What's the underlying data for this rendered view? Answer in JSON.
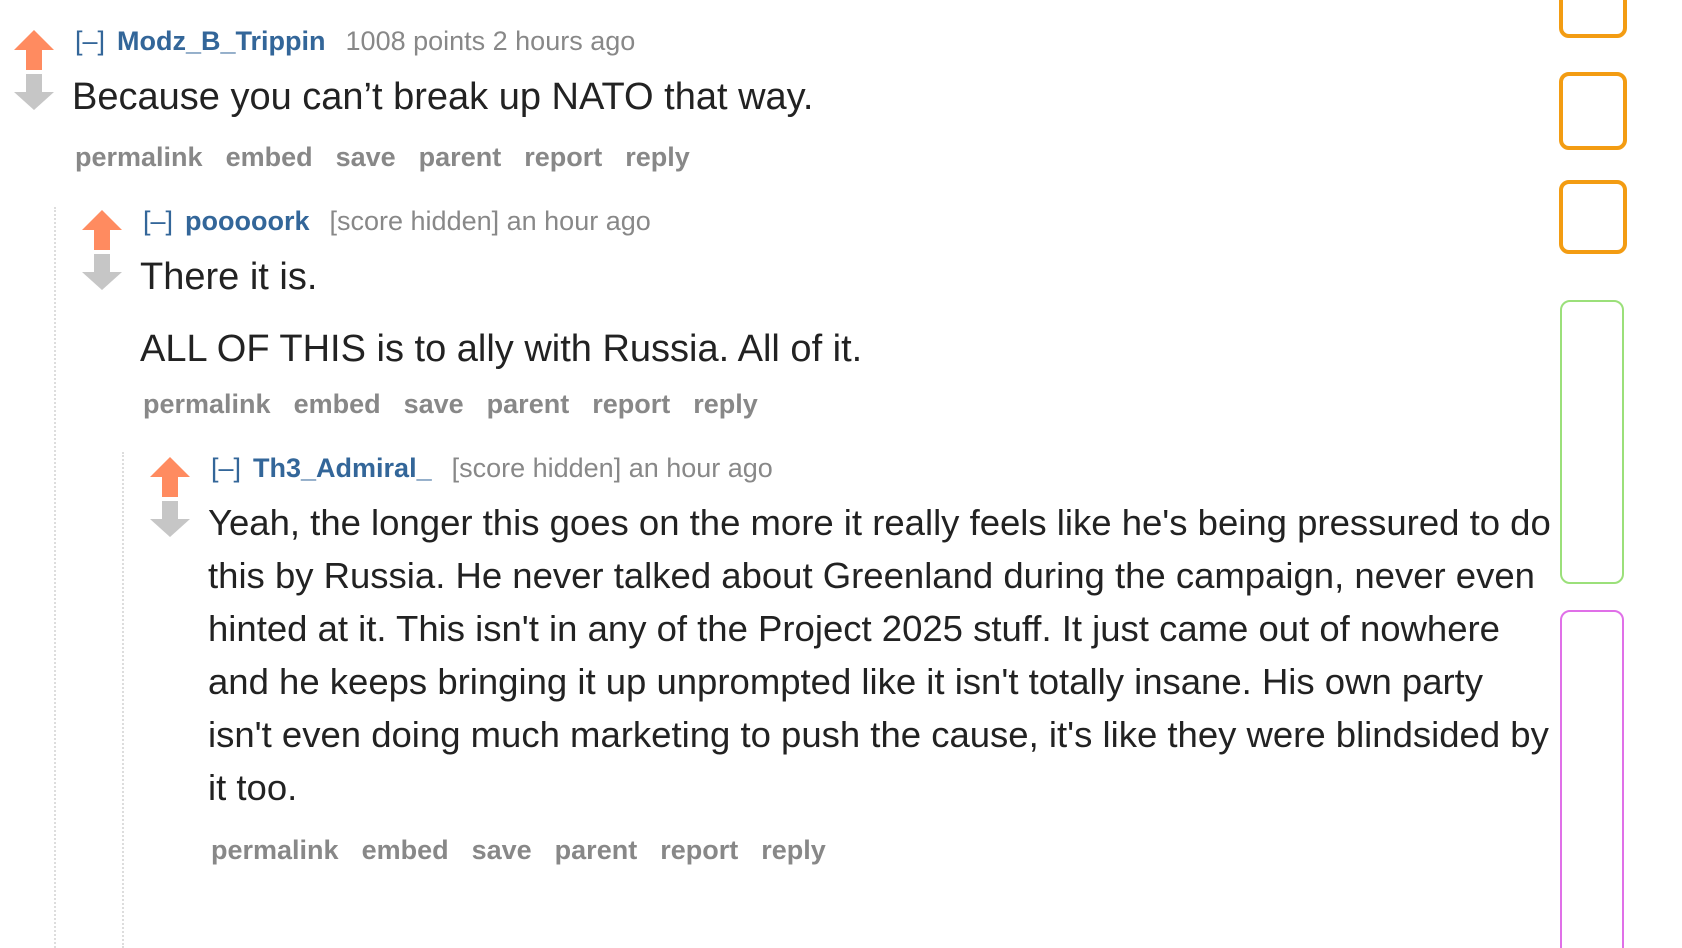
{
  "colors": {
    "upvote": "#ff8b60",
    "downvote": "#c6c6c6",
    "author": "#336699",
    "meta": "#888888",
    "body_text": "#222222"
  },
  "icons": {
    "upvote": "upvote-arrow-icon",
    "downvote": "downvote-arrow-icon"
  },
  "comments": [
    {
      "expand": "[–]",
      "author": "Modz_B_Trippin",
      "meta": "1008 points 2 hours ago",
      "paragraphs": [
        "Because you can’t break up NATO that way."
      ],
      "buttons": [
        "permalink",
        "embed",
        "save",
        "parent",
        "report",
        "reply"
      ]
    },
    {
      "expand": "[–]",
      "author": "pooooork",
      "meta": "[score hidden] an hour ago",
      "paragraphs": [
        "There it is.",
        "ALL OF THIS is to ally with Russia. All of it."
      ],
      "buttons": [
        "permalink",
        "embed",
        "save",
        "parent",
        "report",
        "reply"
      ]
    },
    {
      "expand": "[–]",
      "author": "Th3_Admiral_",
      "meta": "[score hidden] an hour ago",
      "paragraphs": [
        "Yeah, the longer this goes on the more it really feels like he's being pressured to do this by Russia. He never talked about Greenland during the campaign, never even hinted at it. This isn't in any of the Project 2025 stuff. It just came out of nowhere and he keeps bringing it up unprompted like it isn't totally insane. His own party isn't even doing much marketing to push the cause, it's like they were blindsided by it too."
      ],
      "buttons": [
        "permalink",
        "embed",
        "save",
        "parent",
        "report",
        "reply"
      ]
    }
  ]
}
